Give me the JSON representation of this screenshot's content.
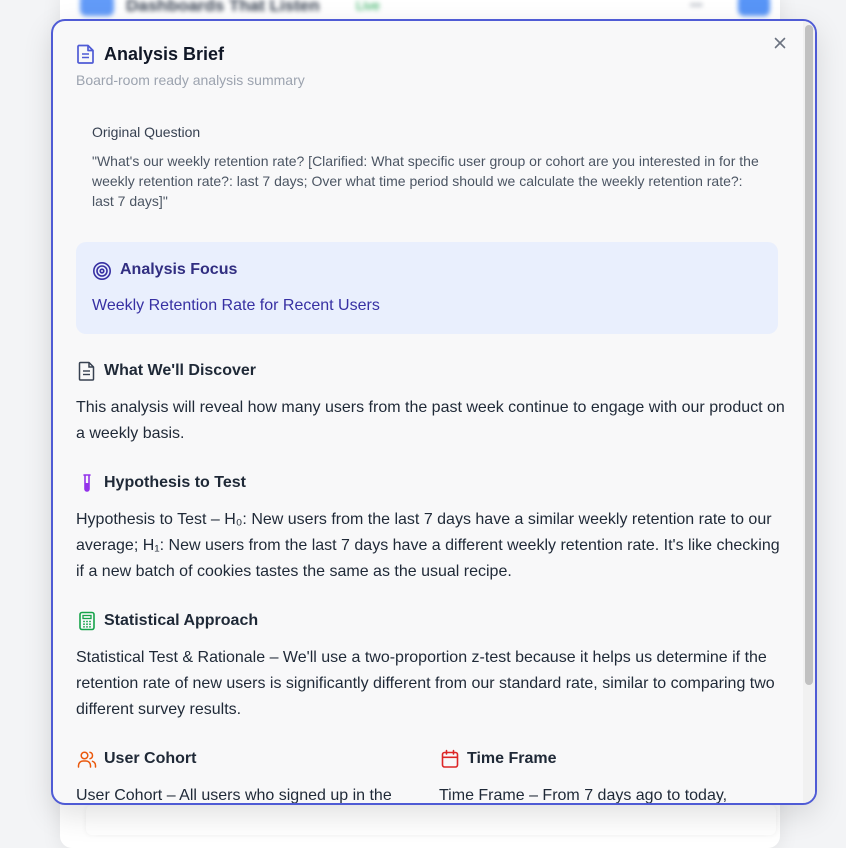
{
  "background": {
    "card_title": "Dashboards That Listen",
    "card_status": "Live"
  },
  "modal": {
    "title": "Analysis Brief",
    "subtitle": "Board-room ready analysis summary",
    "original_question": {
      "label": "Original Question",
      "text": "\"What's our weekly retention rate? [Clarified: What specific user group or cohort are you interested in for the weekly retention rate?: last 7 days; Over what time period should we calculate the weekly retention rate?: last 7 days]\""
    },
    "focus": {
      "label": "Analysis Focus",
      "value": "Weekly Retention Rate for Recent Users"
    },
    "discover": {
      "title": "What We'll Discover",
      "body": "This analysis will reveal how many users from the past week continue to engage with our product on a weekly basis."
    },
    "hypothesis": {
      "title": "Hypothesis to Test",
      "body": "Hypothesis to Test – H₀: New users from the last 7 days have a similar weekly retention rate to our average; H₁: New users from the last 7 days have a different weekly retention rate. It's like checking if a new batch of cookies tastes the same as the usual recipe."
    },
    "approach": {
      "title": "Statistical Approach",
      "body": "Statistical Test & Rationale – We'll use a two-proportion z-test because it helps us determine if the retention rate of new users is significantly different from our standard rate, similar to comparing two different survey results."
    },
    "cohort": {
      "title": "User Cohort",
      "body": "User Cohort – All users who signed up in the"
    },
    "timeframe": {
      "title": "Time Frame",
      "body": "Time Frame – From 7 days ago to today,"
    }
  },
  "colors": {
    "accent": "#4f5bd5",
    "focus_bg": "#e9effd",
    "hypothesis_icon": "#9333ea",
    "approach_icon": "#16a34a",
    "cohort_icon": "#ea580c",
    "timeframe_icon": "#dc2626"
  },
  "icons": {
    "header": "document-icon",
    "close": "close-icon",
    "focus": "target-icon",
    "discover": "document-icon",
    "hypothesis": "test-tube-icon",
    "approach": "calculator-icon",
    "cohort": "users-icon",
    "timeframe": "calendar-icon"
  }
}
